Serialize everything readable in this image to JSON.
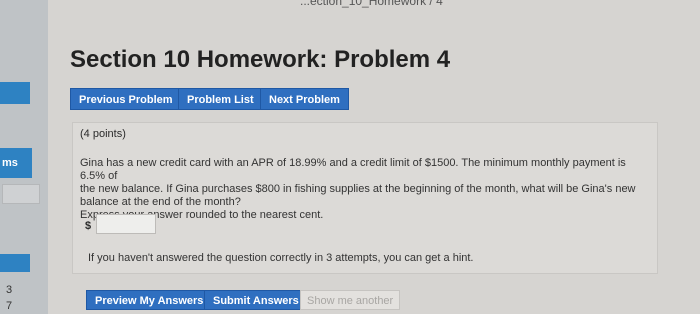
{
  "breadcrumb": "...ection_10_Homework / 4",
  "sidebar": {
    "label_fragment": "ms",
    "numbers": [
      "3",
      "7"
    ]
  },
  "page_title": "Section 10 Homework: Problem 4",
  "nav": {
    "previous": "Previous Problem",
    "list": "Problem List",
    "next": "Next Problem"
  },
  "problem": {
    "points": "(4 points)",
    "text_line1": "Gina has a new credit card with an APR of 18.99% and a credit limit of $1500. The minimum monthly payment is 6.5% of",
    "text_line2": "the new balance. If Gina purchases $800 in fishing supplies at the beginning of the month, what will be Gina's new",
    "text_line3": "balance at the end of the month?",
    "instruction": "Express your answer rounded to the nearest cent.",
    "currency_symbol": "$",
    "answer_value": "",
    "hint": "If you haven't answered the question correctly in 3 attempts, you can get a hint."
  },
  "actions": {
    "preview": "Preview My Answers",
    "submit": "Submit Answers",
    "show_another": "Show me another"
  },
  "colors": {
    "button_blue": "#2f6fc0",
    "sidebar_blue": "#2e82c2",
    "background": "#d6d4d1"
  }
}
